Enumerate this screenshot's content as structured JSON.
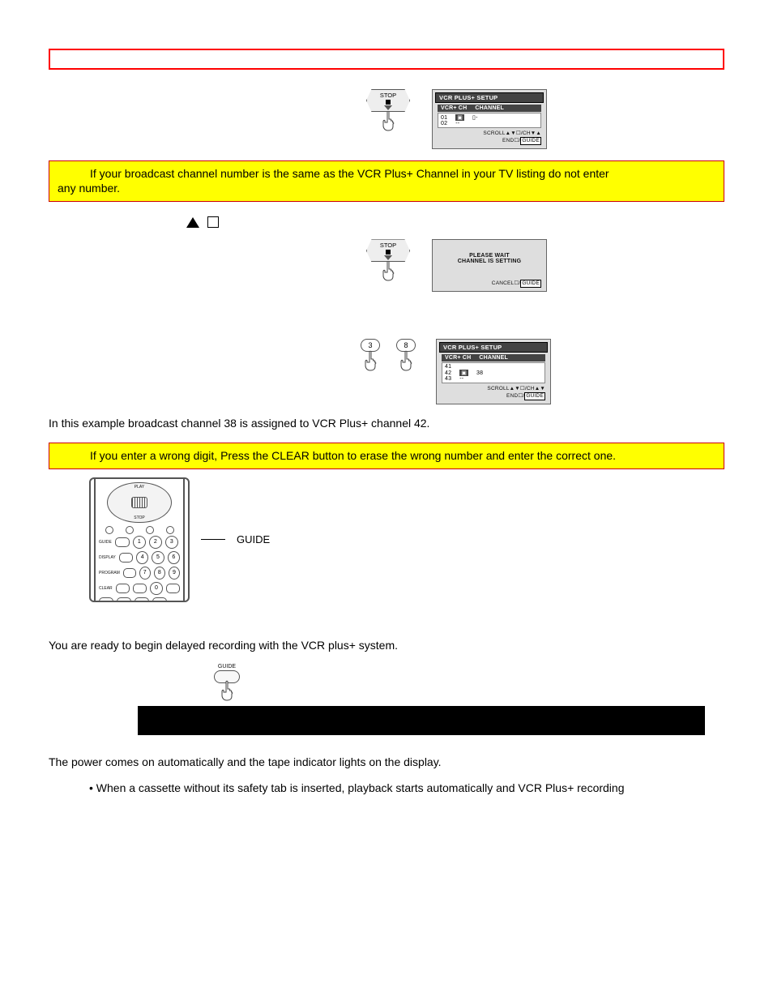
{
  "calloutA": {
    "line1": "If your broadcast channel number is the same as the VCR Plus+ Channel in your TV listing do not enter",
    "line2": "any number."
  },
  "exampleLine": "In this example broadcast channel 38 is assigned to VCR Plus+ channel 42.",
  "calloutB": "If you enter a wrong digit, Press the CLEAR button to erase the wrong number and enter the correct one.",
  "readyLine": "You are ready to begin delayed recording with the VCR plus+ system.",
  "powerLine": "The power comes on automatically and the tape indicator lights on the display.",
  "bullet1": "When a cassette without its safety tab is inserted, playback starts automatically and VCR Plus+ recording",
  "stopLabel": "STOP",
  "guideLabel": "GUIDE",
  "osd1": {
    "title": "VCR PLUS+ SETUP",
    "col1": "VCR+ CH",
    "col2": "CHANNEL",
    "rows": [
      {
        "a": "01",
        "b": "▣",
        "c": "▯-"
      },
      {
        "a": "02",
        "b": "",
        "c": "--"
      }
    ],
    "foot1": "SCROLL▲▼☐/CH▼▲",
    "foot2": "END☐/GUIDE"
  },
  "osd2": {
    "msg1": "PLEASE WAIT",
    "msg2": "CHANNEL IS SETTING",
    "foot": "CANCEL☐/GUIDE"
  },
  "osd3": {
    "title": "VCR PLUS+ SETUP",
    "col1": "VCR+ CH",
    "col2": "CHANNEL",
    "rows": [
      {
        "a": "41",
        "b": ""
      },
      {
        "a": "42",
        "b": "38"
      },
      {
        "a": "43",
        "b": "--"
      }
    ],
    "foot1": "SCROLL▲▼☐/CH▲▼",
    "foot2": "END☐/GUIDE"
  },
  "remote": {
    "play": "PLAY",
    "stop": "STOP",
    "guide_tiny": "GUIDE",
    "display_tiny": "DISPLAY",
    "program_tiny": "PROGRAM",
    "clear_tiny": "CLEAR",
    "nums": [
      [
        "1",
        "2",
        "3"
      ],
      [
        "4",
        "5",
        "6"
      ],
      [
        "7",
        "8",
        "9"
      ],
      [
        "",
        "0",
        ""
      ]
    ]
  },
  "numkeys": [
    "3",
    "8"
  ]
}
